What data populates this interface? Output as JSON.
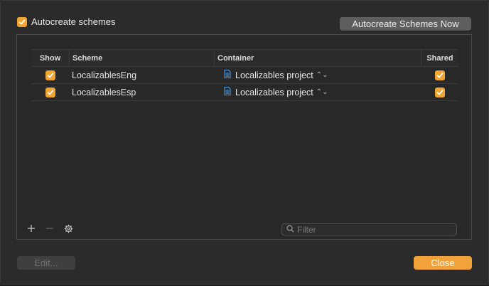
{
  "colors": {
    "accent": "#f0a531",
    "close_button": "#f2a23a",
    "file_icon": "#4aa3f0"
  },
  "header": {
    "autocreate_label": "Autocreate schemes",
    "autocreate_checked": true,
    "autocreate_now_label": "Autocreate Schemes Now"
  },
  "table": {
    "columns": {
      "show": "Show",
      "scheme": "Scheme",
      "container": "Container",
      "shared": "Shared"
    },
    "rows": [
      {
        "show": true,
        "scheme": "LocalizablesEng",
        "container": "Localizables project",
        "container_icon": "file-icon",
        "shared": true
      },
      {
        "show": true,
        "scheme": "LocalizablesEsp",
        "container": "Localizables project",
        "container_icon": "file-icon",
        "shared": true
      }
    ]
  },
  "toolbar": {
    "add_icon": "plus-icon",
    "remove_icon": "minus-icon",
    "settings_icon": "gear-icon"
  },
  "filter": {
    "placeholder": "Filter",
    "value": ""
  },
  "footer": {
    "edit_label": "Edit...",
    "close_label": "Close"
  }
}
